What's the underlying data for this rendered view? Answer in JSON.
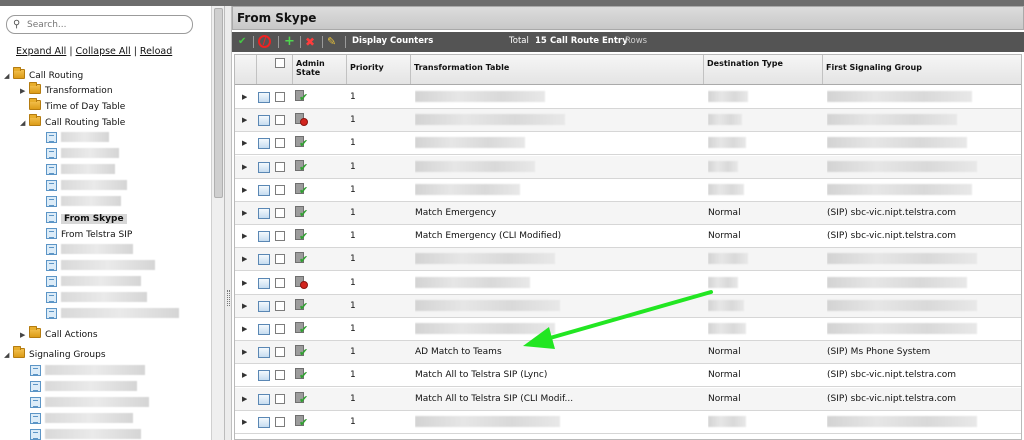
{
  "left": {
    "search_placeholder": "Search...",
    "links": {
      "expand": "Expand All",
      "collapse": "Collapse All",
      "reload": "Reload"
    },
    "tree": {
      "call_routing": "Call Routing",
      "transformation": "Transformation",
      "time_of_day": "Time of Day Table",
      "call_routing_table": "Call Routing Table",
      "from_skype": "From Skype",
      "from_telstra": "From Telstra SIP",
      "call_actions": "Call Actions",
      "signaling_groups": "Signaling Groups"
    }
  },
  "panel": {
    "title": "From Skype",
    "display_counters": "Display Counters",
    "total_prefix": "Total",
    "total_count": "15",
    "total_label": "Call Route Entry",
    "total_suffix": "Rows"
  },
  "columns": {
    "admin_state": "Admin State",
    "priority": "Priority",
    "transformation_table": "Transformation Table",
    "destination_type": "Destination Type",
    "first_signaling_group": "First Signaling Group"
  },
  "rows": [
    {
      "status": "enabled",
      "priority": "1",
      "table": "",
      "dest": "",
      "sg": ""
    },
    {
      "status": "disabled",
      "priority": "1",
      "table": "",
      "dest": "",
      "sg": ""
    },
    {
      "status": "enabled",
      "priority": "1",
      "table": "",
      "dest": "",
      "sg": ""
    },
    {
      "status": "enabled",
      "priority": "1",
      "table": "",
      "dest": "",
      "sg": ""
    },
    {
      "status": "enabled",
      "priority": "1",
      "table": "",
      "dest": "",
      "sg": ""
    },
    {
      "status": "enabled",
      "priority": "1",
      "table": "Match Emergency",
      "dest": "Normal",
      "sg": "(SIP) sbc-vic.nipt.telstra.com"
    },
    {
      "status": "enabled",
      "priority": "1",
      "table": "Match Emergency (CLI Modified)",
      "dest": "Normal",
      "sg": "(SIP) sbc-vic.nipt.telstra.com"
    },
    {
      "status": "enabled",
      "priority": "1",
      "table": "",
      "dest": "",
      "sg": ""
    },
    {
      "status": "disabled",
      "priority": "1",
      "table": "",
      "dest": "",
      "sg": ""
    },
    {
      "status": "enabled",
      "priority": "1",
      "table": "",
      "dest": "",
      "sg": ""
    },
    {
      "status": "enabled",
      "priority": "1",
      "table": "",
      "dest": "",
      "sg": ""
    },
    {
      "status": "enabled",
      "priority": "1",
      "table": "AD Match to Teams",
      "dest": "Normal",
      "sg": "(SIP) Ms Phone System"
    },
    {
      "status": "enabled",
      "priority": "1",
      "table": "Match All to Telstra SIP (Lync)",
      "dest": "Normal",
      "sg": "(SIP) sbc-vic.nipt.telstra.com"
    },
    {
      "status": "enabled",
      "priority": "1",
      "table": "Match All to Telstra SIP (CLI Modif...",
      "dest": "Normal",
      "sg": "(SIP) sbc-vic.nipt.telstra.com"
    },
    {
      "status": "enabled",
      "priority": "1",
      "table": "",
      "dest": "",
      "sg": ""
    }
  ],
  "colors": {
    "annotation_arrow": "#22e622",
    "toolbar": "#545454"
  }
}
